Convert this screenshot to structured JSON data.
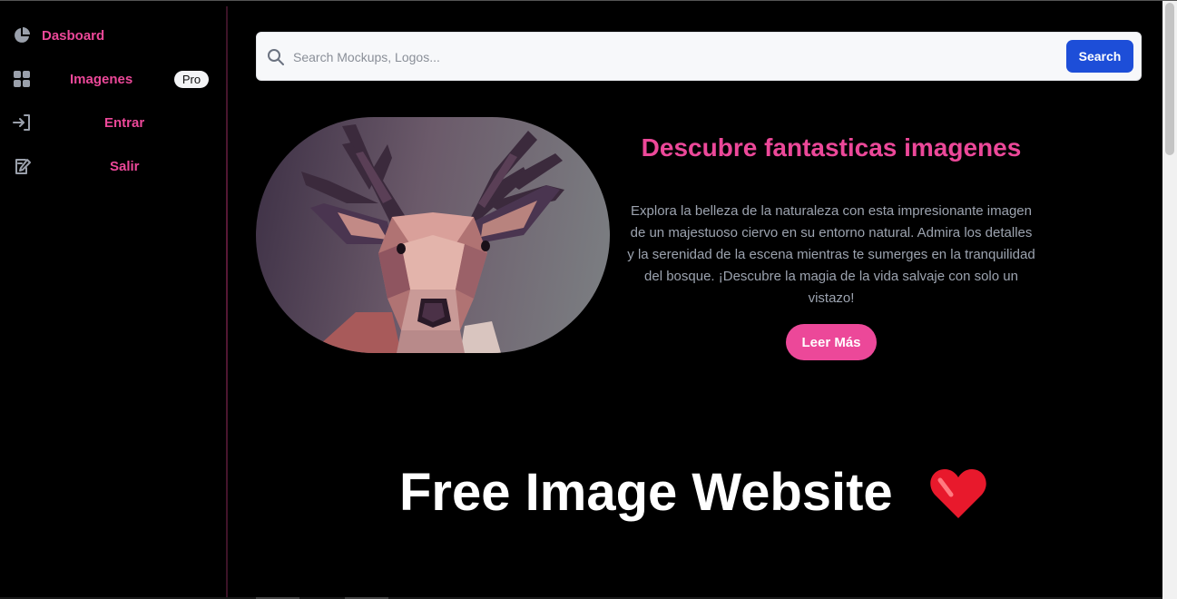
{
  "sidebar": {
    "items": [
      {
        "label": "Dasboard",
        "icon": "pie-chart-icon"
      },
      {
        "label": "Imagenes",
        "icon": "grid-icon",
        "badge": "Pro"
      },
      {
        "label": "Entrar",
        "icon": "login-icon"
      },
      {
        "label": "Salir",
        "icon": "edit-document-icon"
      }
    ]
  },
  "search": {
    "placeholder": "Search Mockups, Logos...",
    "value": "",
    "button_label": "Search"
  },
  "hero": {
    "image_icon": "low-poly-deer-image",
    "title": "Descubre fantasticas imagenes",
    "text": "Explora la belleza de la naturaleza con esta impresionante imagen de un majestuoso ciervo en su entorno natural. Admira los detalles y la serenidad de la escena mientras te sumerges en la tranquilidad del bosque. ¡Descubre la magia de la vida salvaje con solo un vistazo!",
    "button_label": "Leer Más"
  },
  "footer_banner": {
    "title": "Free Image Website",
    "emoji_icon": "red-heart-icon"
  },
  "colors": {
    "accent": "#ec4899",
    "search_button": "#1d4ed8",
    "background": "#000000",
    "muted_text": "#9ca3af"
  }
}
